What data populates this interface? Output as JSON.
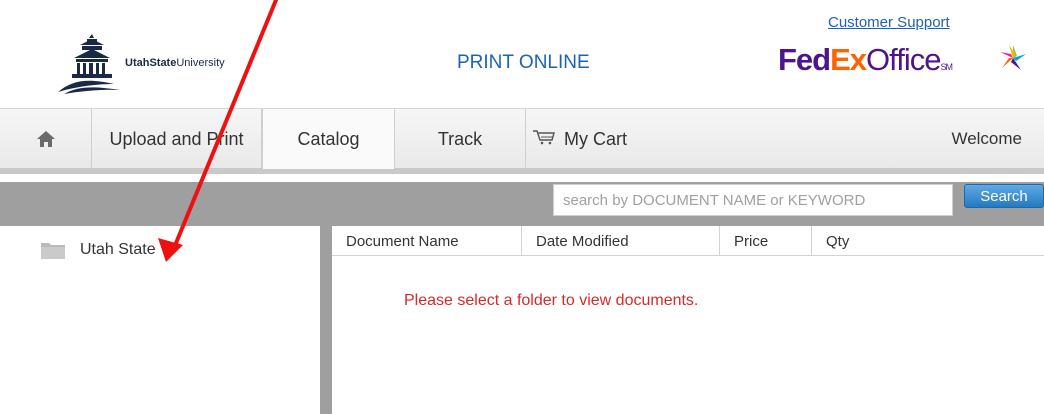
{
  "header": {
    "university": {
      "prefix": "UtahState",
      "suffix": "University"
    },
    "title": "PRINT ONLINE",
    "support_link": "Customer Support",
    "fedex": {
      "fed": "Fed",
      "ex": "Ex",
      "office": "Office",
      "sm": "SM"
    }
  },
  "nav": {
    "upload": "Upload and Print",
    "catalog": "Catalog",
    "track": "Track",
    "cart": "My Cart",
    "welcome": "Welcome"
  },
  "search": {
    "placeholder": "search by DOCUMENT NAME or KEYWORD",
    "button": "Search"
  },
  "folders": [
    {
      "label": "Utah State"
    }
  ],
  "table": {
    "columns": [
      "Document Name",
      "Date Modified",
      "Price",
      "Qty"
    ],
    "empty_message": "Please select a folder to view documents."
  },
  "colors": {
    "link_blue": "#1d63b5",
    "fedex_purple": "#4d148c",
    "fedex_orange": "#ff6200",
    "message_red": "#d62a2a",
    "annotation_red": "#ee1111"
  }
}
